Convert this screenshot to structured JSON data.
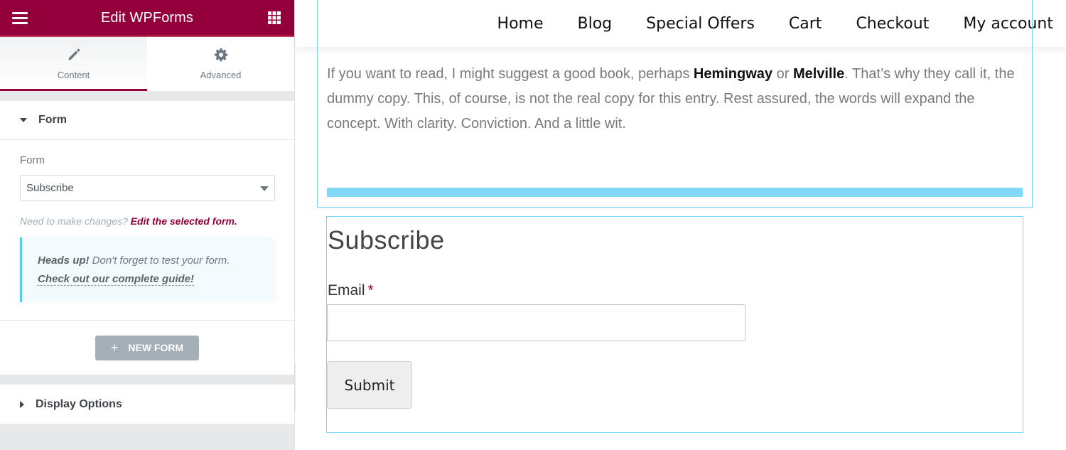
{
  "panel": {
    "title": "Edit WPForms",
    "menu_icon": "hamburger-icon",
    "apps_icon": "grid-icon",
    "tabs": [
      {
        "label": "Content",
        "icon": "pencil-icon",
        "active": true
      },
      {
        "label": "Advanced",
        "icon": "gear-icon",
        "active": false
      }
    ],
    "form_section": {
      "title": "Form",
      "expanded": true,
      "field_label": "Form",
      "selected_form": "Subscribe",
      "hint_prefix": "Need to make changes?",
      "hint_link": "Edit the selected form.",
      "notice_bold": "Heads up!",
      "notice_text": " Don't forget to test your form.",
      "notice_link": "Check out our complete guide!",
      "new_form_label": "New Form"
    },
    "display_section": {
      "title": "Display Options",
      "expanded": false
    }
  },
  "preview": {
    "nav": [
      "Home",
      "Blog",
      "Special Offers",
      "Cart",
      "Checkout",
      "My account"
    ],
    "body": {
      "t1": "If you want to read, I might suggest a good book, perhaps ",
      "b1": "Hemingway",
      "t2": " or ",
      "b2": "Melville",
      "t3": ". That’s why they call it, the dummy copy. This, of course, is not the real copy for this entry. Rest assured, the words will expand the concept. With clarity. Conviction. And a little wit."
    },
    "form": {
      "title": "Subscribe",
      "email_label": "Email",
      "required_mark": "*",
      "email_value": "",
      "submit_label": "Submit"
    }
  },
  "colors": {
    "brand": "#93003a",
    "outline": "#71d7f7",
    "divider": "#81d9f7",
    "notice_border": "#5bc8f2"
  }
}
